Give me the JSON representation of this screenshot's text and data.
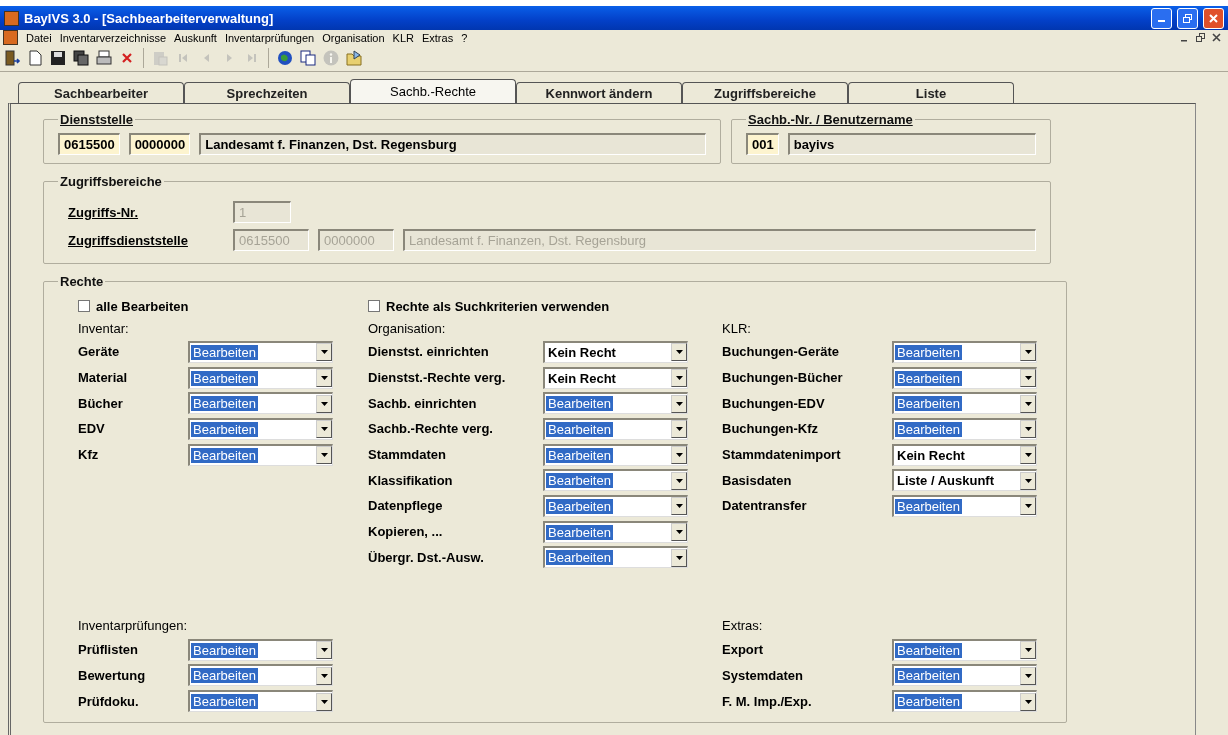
{
  "window": {
    "title": "BayIVS 3.0 - [Sachbearbeiterverwaltung]"
  },
  "menu": [
    "Datei",
    "Inventarverzeichnisse",
    "Auskunft",
    "Inventarprüfungen",
    "Organisation",
    "KLR",
    "Extras",
    "?"
  ],
  "toolbar": [
    {
      "kind": "exit",
      "disabled": false
    },
    {
      "kind": "new",
      "disabled": false
    },
    {
      "kind": "save",
      "disabled": false
    },
    {
      "kind": "copies",
      "disabled": false
    },
    {
      "kind": "print",
      "disabled": false
    },
    {
      "kind": "delete",
      "disabled": false
    },
    {
      "kind": "separator"
    },
    {
      "kind": "paste",
      "disabled": true
    },
    {
      "kind": "first",
      "disabled": true
    },
    {
      "kind": "prev",
      "disabled": true
    },
    {
      "kind": "next",
      "disabled": true
    },
    {
      "kind": "last",
      "disabled": true
    },
    {
      "kind": "separator"
    },
    {
      "kind": "globe",
      "disabled": false
    },
    {
      "kind": "copy",
      "disabled": false
    },
    {
      "kind": "info",
      "disabled": true
    },
    {
      "kind": "folder",
      "disabled": false
    }
  ],
  "tabs": [
    {
      "label": "Sachbearbeiter",
      "selected": false
    },
    {
      "label": "Sprechzeiten",
      "selected": false
    },
    {
      "label": "Sachb.-Rechte",
      "selected": true
    },
    {
      "label": "Kennwort ändern",
      "selected": false
    },
    {
      "label": "Zugriffsbereiche",
      "selected": false
    },
    {
      "label": "Liste",
      "selected": false
    }
  ],
  "dienststelle": {
    "title": "Dienststelle",
    "underlined": true,
    "fields": [
      {
        "value": "0615500",
        "kind": "key",
        "disabled": false
      },
      {
        "value": "0000000",
        "kind": "key",
        "disabled": false
      },
      {
        "value": "Landesamt f. Finanzen, Dst. Regensburg",
        "kind": "display",
        "disabled": false
      }
    ]
  },
  "benutzer": {
    "title": "Sachb.-Nr. / Benutzername",
    "underlined": true,
    "fields": [
      {
        "value": "001",
        "kind": "key",
        "disabled": false
      },
      {
        "value": "bayivs",
        "kind": "display",
        "disabled": false
      }
    ]
  },
  "zugriffsbereiche": {
    "title": "Zugriffsbereiche",
    "underlined": false,
    "rows": [
      {
        "label": "Zugriffs-Nr.",
        "underlined": true,
        "fields": [
          {
            "value": "1",
            "kind": "display",
            "disabled": true
          }
        ]
      },
      {
        "label": "Zugriffsdienststelle",
        "underlined": true,
        "fields": [
          {
            "value": "0615500",
            "kind": "display",
            "disabled": true
          },
          {
            "value": "0000000",
            "kind": "display",
            "disabled": true
          },
          {
            "value": "Landesamt f. Finanzen, Dst. Regensburg",
            "kind": "display",
            "disabled": true
          }
        ]
      }
    ]
  },
  "rechte": {
    "title": "Rechte",
    "underlined": false,
    "checkboxes": [
      {
        "label": "alle Bearbeiten",
        "checked": false
      },
      {
        "label": "Rechte als Suchkriterien verwenden",
        "checked": false
      }
    ],
    "columns": [
      {
        "sections": [
          {
            "heading": "Inventar:",
            "rows": [
              {
                "label": "Geräte",
                "value": "Bearbeiten",
                "highlighted": true
              },
              {
                "label": "Material",
                "value": "Bearbeiten",
                "highlighted": true
              },
              {
                "label": "Bücher",
                "value": "Bearbeiten",
                "highlighted": true
              },
              {
                "label": "EDV",
                "value": "Bearbeiten",
                "highlighted": true
              },
              {
                "label": "Kfz",
                "value": "Bearbeiten",
                "highlighted": true
              }
            ]
          },
          {
            "heading": "Inventarprüfungen:",
            "rows": [
              {
                "label": "Prüflisten",
                "value": "Bearbeiten",
                "highlighted": true
              },
              {
                "label": "Bewertung",
                "value": "Bearbeiten",
                "highlighted": true
              },
              {
                "label": "Prüfdoku.",
                "value": "Bearbeiten",
                "highlighted": true
              }
            ]
          }
        ]
      },
      {
        "sections": [
          {
            "heading": "Organisation:",
            "rows": [
              {
                "label": "Dienstst. einrichten",
                "value": "Kein Recht",
                "highlighted": false
              },
              {
                "label": "Dienstst.-Rechte verg.",
                "value": "Kein Recht",
                "highlighted": false
              },
              {
                "label": "Sachb. einrichten",
                "value": "Bearbeiten",
                "highlighted": true
              },
              {
                "label": "Sachb.-Rechte verg.",
                "value": "Bearbeiten",
                "highlighted": true
              },
              {
                "label": "Stammdaten",
                "value": "Bearbeiten",
                "highlighted": true
              },
              {
                "label": "Klassifikation",
                "value": "Bearbeiten",
                "highlighted": true
              },
              {
                "label": "Datenpflege",
                "value": "Bearbeiten",
                "highlighted": true
              },
              {
                "label": "Kopieren, ...",
                "value": "Bearbeiten",
                "highlighted": true
              },
              {
                "label": "Übergr. Dst.-Ausw.",
                "value": "Bearbeiten",
                "highlighted": true
              }
            ]
          }
        ]
      },
      {
        "sections": [
          {
            "heading": "KLR:",
            "rows": [
              {
                "label": "Buchungen-Geräte",
                "value": "Bearbeiten",
                "highlighted": true
              },
              {
                "label": "Buchungen-Bücher",
                "value": "Bearbeiten",
                "highlighted": true
              },
              {
                "label": "Buchungen-EDV",
                "value": "Bearbeiten",
                "highlighted": true
              },
              {
                "label": "Buchungen-Kfz",
                "value": "Bearbeiten",
                "highlighted": true
              },
              {
                "label": "Stammdatenimport",
                "value": "Kein Recht",
                "highlighted": false
              },
              {
                "label": "Basisdaten",
                "value": "Liste / Auskunft",
                "highlighted": false
              },
              {
                "label": "Datentransfer",
                "value": "Bearbeiten",
                "highlighted": true
              }
            ]
          },
          {
            "heading": "Extras:",
            "rows": [
              {
                "label": "Export",
                "value": "Bearbeiten",
                "highlighted": true
              },
              {
                "label": "Systemdaten",
                "value": "Bearbeiten",
                "highlighted": true
              },
              {
                "label": "F. M. Imp./Exp.",
                "value": "Bearbeiten",
                "highlighted": true
              }
            ]
          }
        ]
      }
    ]
  }
}
